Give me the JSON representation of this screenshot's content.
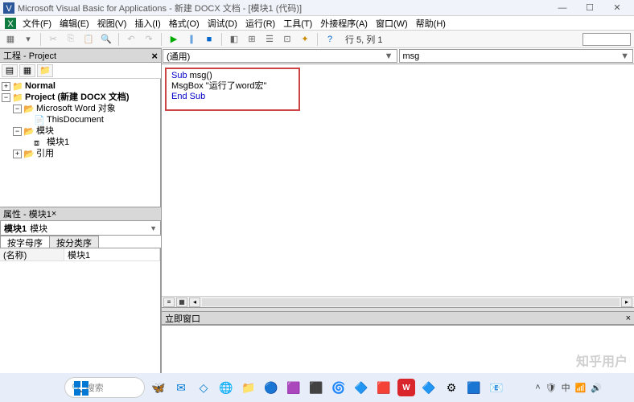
{
  "titlebar": {
    "title": "Microsoft Visual Basic for Applications - 新建 DOCX 文档 - [模块1 (代码)]"
  },
  "menubar": {
    "items": [
      "文件(F)",
      "编辑(E)",
      "视图(V)",
      "插入(I)",
      "格式(O)",
      "调试(D)",
      "运行(R)",
      "工具(T)",
      "外接程序(A)",
      "窗口(W)",
      "帮助(H)"
    ]
  },
  "toolbar": {
    "status": "行 5, 列 1"
  },
  "projectPane": {
    "title": "工程 - Project"
  },
  "tree": {
    "l0": "Normal",
    "l1": "Project (新建 DOCX 文档)",
    "l2": "Microsoft Word 对象",
    "l3": "ThisDocument",
    "l4": "模块",
    "l5": "模块1",
    "l6": "引用"
  },
  "propsPane": {
    "title": "属性 - 模块1",
    "objName": "模块1",
    "objType": "模块",
    "tab1": "按字母序",
    "tab2": "按分类序",
    "row_k": "(名称)",
    "row_v": "模块1"
  },
  "codeHeader": {
    "left": "(通用)",
    "right": "msg"
  },
  "code": {
    "l1a": "Sub",
    "l1b": " msg()",
    "l2": "    MsgBox \"运行了word宏\"",
    "l3": "",
    "l4a": "End Sub"
  },
  "immediate": {
    "title": "立即窗口"
  },
  "taskbar": {
    "search": "搜索"
  },
  "watermark": "知乎用户"
}
